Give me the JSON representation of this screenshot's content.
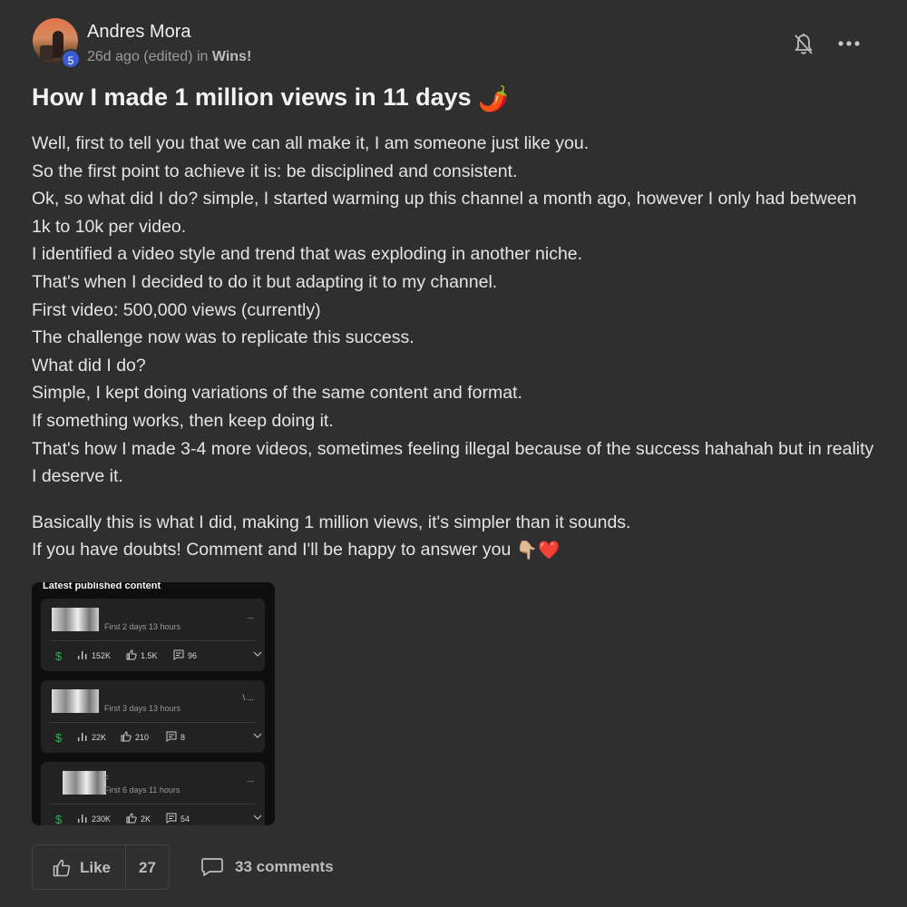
{
  "post": {
    "author": "Andres Mora",
    "level": "5",
    "time_meta": "26d ago (edited) in ",
    "category": "Wins!",
    "title": "How I made 1 million views in 11 days",
    "title_emoji": "🌶️",
    "paragraphs": [
      "Well, first to tell you that we can all make it, I am someone just like you.",
      "So the first point to achieve it is: be disciplined and consistent.",
      "Ok, so what did I do? simple, I started warming up this channel a month ago, however I only had between 1k to 10k per video.",
      "I identified a video style and trend that was exploding in another niche.",
      "That's when I decided to do it but adapting it to my channel.",
      "First video: 500,000 views (currently)",
      "The challenge now was to replicate this success.",
      "What did I do?",
      "Simple, I kept doing variations of the same content and format.",
      "If something works, then keep doing it.",
      "That's how I made 3-4 more videos, sometimes feeling illegal because of the success hahahah but in reality I deserve it."
    ],
    "paragraphs_2": [
      "Basically this is what I did, making 1 million views, it's simpler than it sounds.",
      "If you have doubts! Comment and I'll be happy to answer you"
    ],
    "closing_emoji": "👇🏼❤️"
  },
  "embedded_screenshot": {
    "header": "Latest published content",
    "cards": [
      {
        "label": "",
        "time": "First 2 days 13 hours",
        "views": "152K",
        "likes": "1.5K",
        "comments": "96",
        "dots": "..."
      },
      {
        "label": "",
        "time": "First 3 days 13 hours",
        "views": "22K",
        "likes": "210",
        "comments": "8",
        "dots": "\\ ..."
      },
      {
        "label": "F",
        "time": "First 6 days 11 hours",
        "views": "230K",
        "likes": "2K",
        "comments": "54",
        "dots": "..."
      }
    ]
  },
  "actions": {
    "like_label": "Like",
    "like_count": "27",
    "comments_label": "33 comments"
  },
  "icons": [
    "bell-off-icon",
    "more-options-icon",
    "thumbs-up-icon",
    "comment-bubble-icon",
    "dollar-icon",
    "bar-chart-icon",
    "comment-icon",
    "chevron-down-icon"
  ],
  "colors": {
    "background": "#2f2f2f",
    "level_badge": "#3b5bd1",
    "dollar_green": "#2fae4e"
  }
}
